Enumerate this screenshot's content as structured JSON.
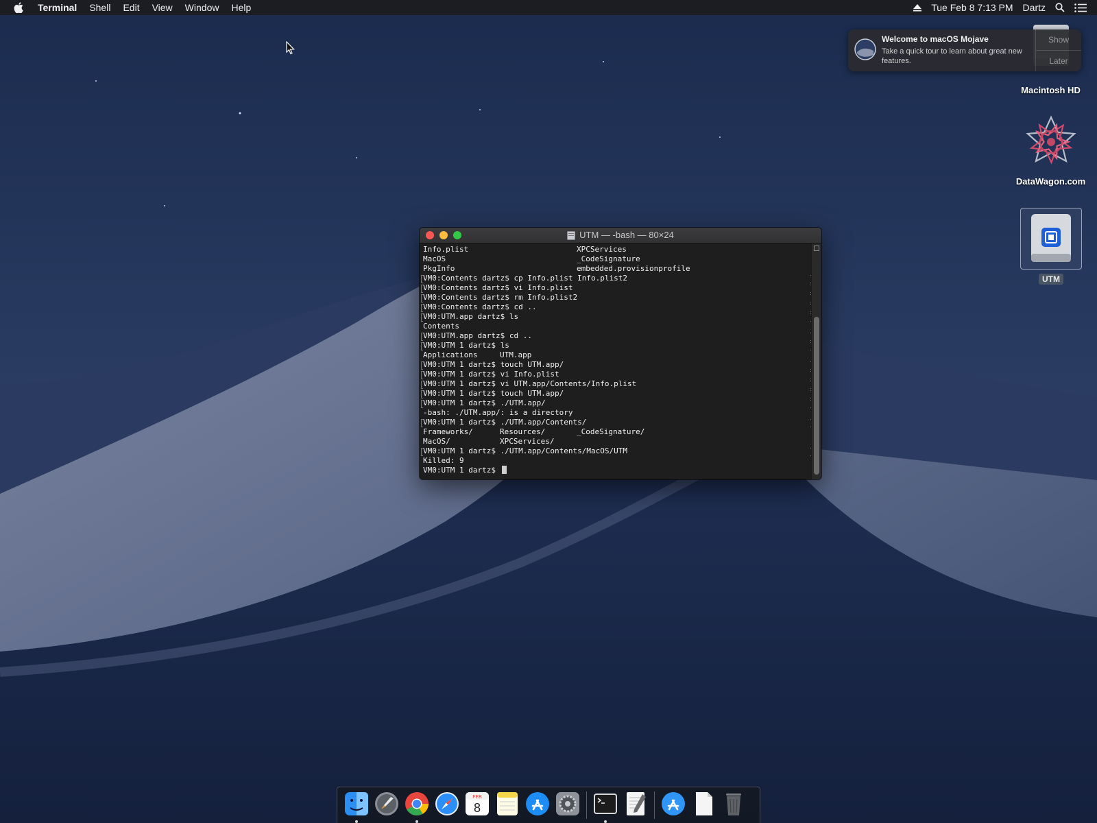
{
  "menubar": {
    "app_name": "Terminal",
    "items": [
      "Shell",
      "Edit",
      "View",
      "Window",
      "Help"
    ],
    "datetime": "Tue Feb 8  7:13 PM",
    "user": "Dartz"
  },
  "notification": {
    "title": "Welcome to macOS Mojave",
    "text": "Take a quick tour to learn about great new features.",
    "show_label": "Show",
    "later_label": "Later"
  },
  "desktop": {
    "macintosh_hd": "Macintosh HD",
    "datawagon": "DataWagon.com",
    "utm": "UTM"
  },
  "terminal": {
    "title": "UTM — -bash — 80×24",
    "lines": [
      {
        "col1": "Info.plist",
        "col2": "XPCServices",
        "cmd": false
      },
      {
        "col1": "MacOS",
        "col2": "_CodeSignature",
        "cmd": false
      },
      {
        "col1": "PkgInfo",
        "col2": "embedded.provisionprofile",
        "cmd": false
      },
      {
        "col1": "VM0:Contents dartz$ cp Info.plist Info.plist2",
        "cmd": true
      },
      {
        "col1": "VM0:Contents dartz$ vi Info.plist",
        "cmd": true
      },
      {
        "col1": "VM0:Contents dartz$ rm Info.plist2",
        "cmd": true
      },
      {
        "col1": "VM0:Contents dartz$ cd ..",
        "cmd": true
      },
      {
        "col1": "VM0:UTM.app dartz$ ls",
        "cmd": true
      },
      {
        "col1": "Contents",
        "cmd": false
      },
      {
        "col1": "VM0:UTM.app dartz$ cd ..",
        "cmd": true
      },
      {
        "col1": "VM0:UTM 1 dartz$ ls",
        "cmd": true
      },
      {
        "col1": "Applications",
        "colmid": "UTM.app",
        "cmd": false
      },
      {
        "col1": "VM0:UTM 1 dartz$ touch UTM.app/",
        "cmd": true
      },
      {
        "col1": "VM0:UTM 1 dartz$ vi Info.plist",
        "cmd": true
      },
      {
        "col1": "VM0:UTM 1 dartz$ vi UTM.app/Contents/Info.plist",
        "cmd": true
      },
      {
        "col1": "VM0:UTM 1 dartz$ touch UTM.app/",
        "cmd": true
      },
      {
        "col1": "VM0:UTM 1 dartz$ ./UTM.app/",
        "cmd": true
      },
      {
        "col1": "-bash: ./UTM.app/: is a directory",
        "cmd": false
      },
      {
        "col1": "VM0:UTM 1 dartz$ ./UTM.app/Contents/",
        "cmd": true
      },
      {
        "col1": "Frameworks/",
        "colmid": "Resources/",
        "col2": "_CodeSignature/",
        "cmd": false
      },
      {
        "col1": "MacOS/",
        "colmid": "XPCServices/",
        "cmd": false
      },
      {
        "col1": "VM0:UTM 1 dartz$ ./UTM.app/Contents/MacOS/UTM",
        "cmd": true
      },
      {
        "col1": "Killed: 9",
        "cmd": false
      },
      {
        "col1": "VM0:UTM 1 dartz$ ",
        "cmd": false,
        "prompt": true
      }
    ]
  },
  "dock": {
    "items": [
      {
        "icon": "finder-icon",
        "running": true
      },
      {
        "icon": "launchpad-icon",
        "running": false
      },
      {
        "icon": "chrome-icon",
        "running": true
      },
      {
        "icon": "safari-icon",
        "running": false
      },
      {
        "icon": "calendar-icon",
        "running": false,
        "month": "FEB",
        "day": "8"
      },
      {
        "icon": "notes-icon",
        "running": false
      },
      {
        "icon": "app-store-icon",
        "running": false
      },
      {
        "icon": "system-preferences-icon",
        "running": false
      },
      {
        "separator": true
      },
      {
        "icon": "terminal-icon",
        "running": true
      },
      {
        "icon": "textedit-icon",
        "running": false
      },
      {
        "separator": true
      },
      {
        "icon": "app-store-folder-icon",
        "running": false
      },
      {
        "icon": "documents-icon",
        "running": false
      },
      {
        "icon": "trash-icon",
        "running": false
      }
    ]
  }
}
